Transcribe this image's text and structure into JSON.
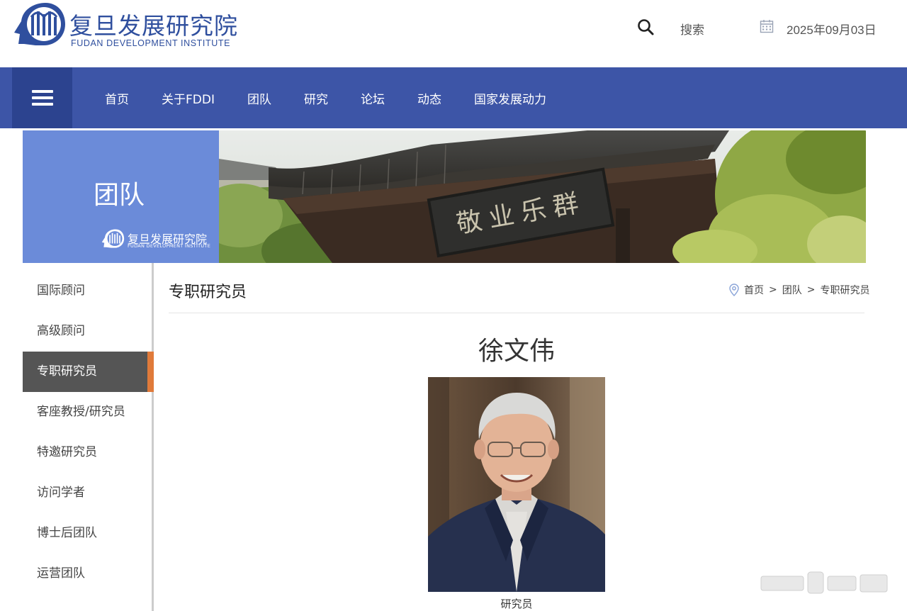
{
  "header": {
    "logo_cn": "复旦发展研究院",
    "logo_en": "FUDAN DEVELOPMENT INSTITUTE",
    "search_label": "搜索",
    "date": "2025年09月03日"
  },
  "nav": {
    "items": [
      {
        "label": "首页"
      },
      {
        "label": "关于FDDI"
      },
      {
        "label": "团队"
      },
      {
        "label": "研究"
      },
      {
        "label": "论坛"
      },
      {
        "label": "动态"
      },
      {
        "label": "国家发展动力"
      }
    ]
  },
  "banner": {
    "title": "团队",
    "logo_cn": "复旦发展研究院",
    "logo_en": "FUDAN DEVELOPMENT INSTITUTE",
    "plaque_text": "敬业乐群"
  },
  "sidebar": {
    "items": [
      {
        "label": "国际顾问"
      },
      {
        "label": "高级顾问"
      },
      {
        "label": "专职研究员",
        "active": true
      },
      {
        "label": "客座教授/研究员"
      },
      {
        "label": "特邀研究员"
      },
      {
        "label": "访问学者"
      },
      {
        "label": "博士后团队"
      },
      {
        "label": "运营团队"
      }
    ]
  },
  "content": {
    "section_title": "专职研究员",
    "breadcrumb": [
      "首页",
      "团队",
      "专职研究员"
    ],
    "breadcrumb_sep": ">",
    "person_name": "徐文伟",
    "photo_caption": "研究员"
  },
  "colors": {
    "brand_blue": "#3d55a7",
    "brand_dark_blue": "#2c438f",
    "banner_side": "#6b8bd9",
    "active_item": "#555555",
    "active_accent": "#e07a3a"
  },
  "icons": {
    "search": "search-icon",
    "calendar": "calendar-icon",
    "menu": "hamburger-menu-icon",
    "location": "location-pin-icon"
  }
}
